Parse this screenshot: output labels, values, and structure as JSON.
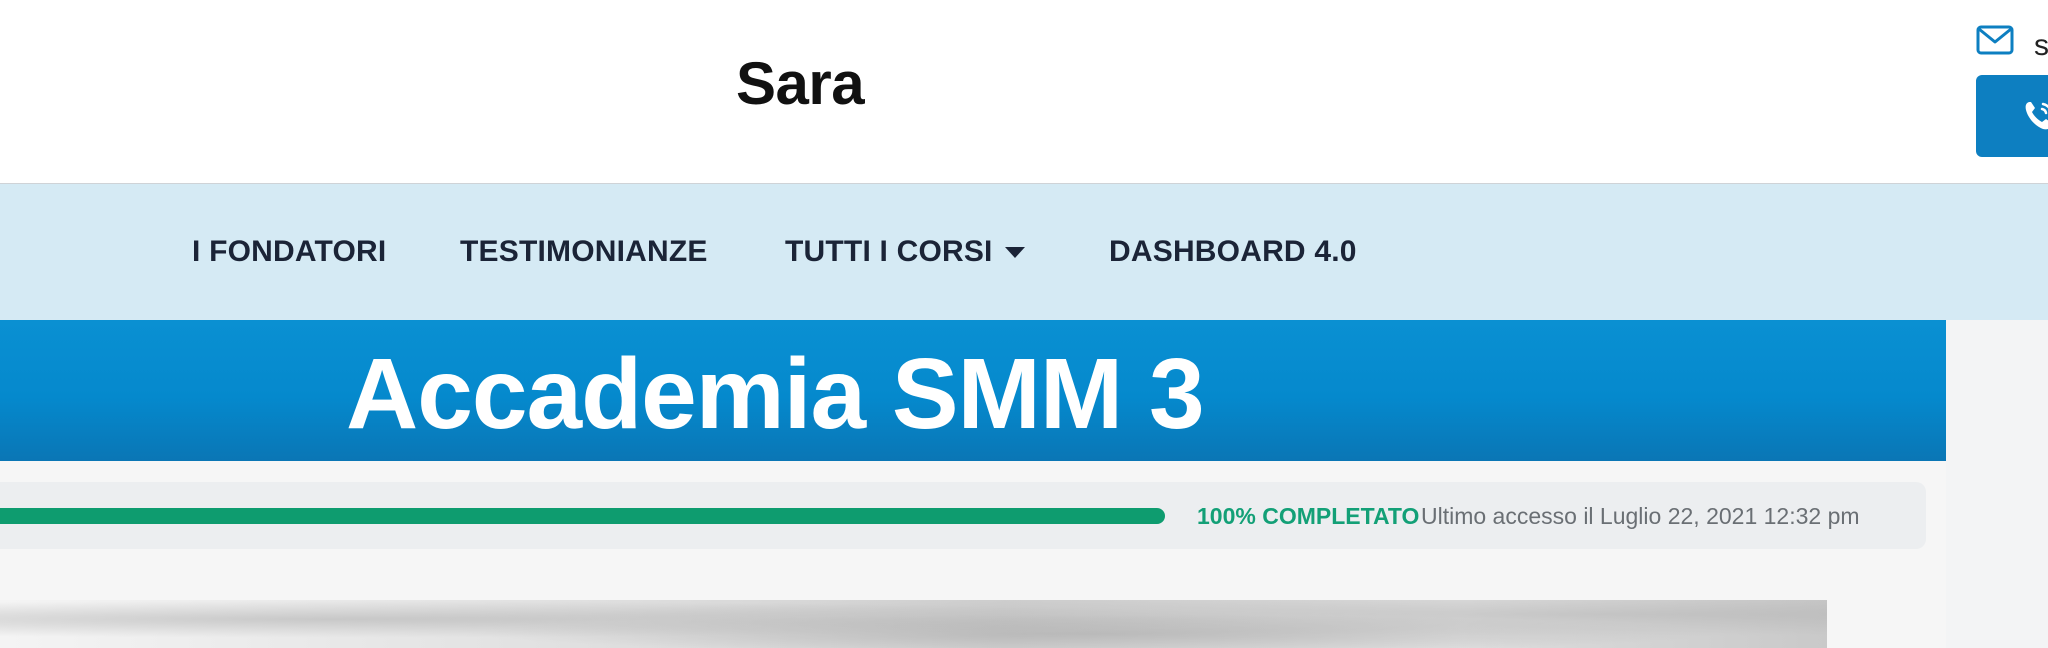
{
  "header": {
    "user_name": "Sara",
    "mail_icon": "envelope-icon",
    "mail_text": "s",
    "phone_icon": "phone-icon"
  },
  "nav": {
    "items": [
      {
        "label": "I FONDATORI"
      },
      {
        "label": "TESTIMONIANZE"
      },
      {
        "label": "TUTTI I CORSI",
        "icon": "chevron-down-icon"
      },
      {
        "label": "DASHBOARD 4.0"
      }
    ]
  },
  "course": {
    "title": "Accademia SMM 3"
  },
  "progress": {
    "percent_value": 100,
    "percent_label": "100% COMPLETATO",
    "last_access": "Ultimo accesso il Luglio 22, 2021 12:32 pm"
  },
  "colors": {
    "accent_blue": "#0d7fc1",
    "banner_blue": "#0589cd",
    "nav_background": "#d5eaf4",
    "progress_green": "#0e9c6f",
    "nav_text": "#1b2437"
  }
}
